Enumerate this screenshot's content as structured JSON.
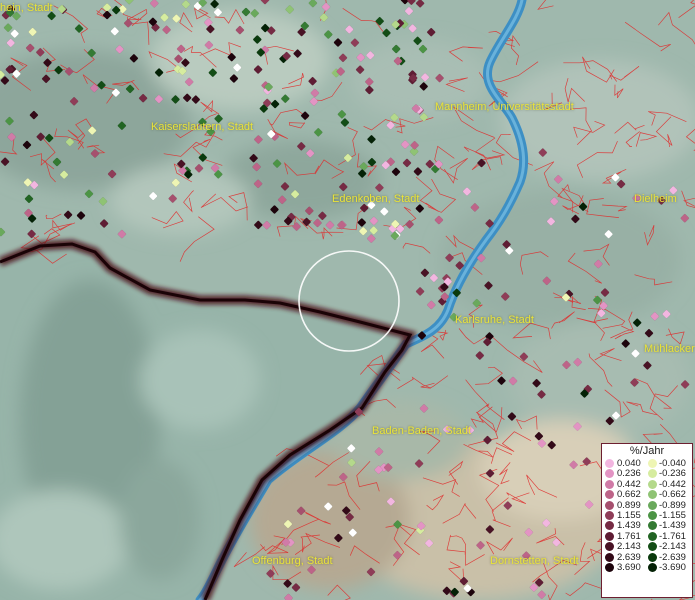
{
  "map": {
    "cities": [
      {
        "id": "ludwigshafen",
        "label": "hein, Stadt"
      },
      {
        "id": "kaiserslautern",
        "label": "Kaiserslautern, Stadt"
      },
      {
        "id": "mannheim",
        "label": "Mannheim, Universitätsstadt"
      },
      {
        "id": "edenkoben",
        "label": "Edenkoben, Stadt"
      },
      {
        "id": "dielheim",
        "label": "Dielheim"
      },
      {
        "id": "karlsruhe",
        "label": "Karlsruhe, Stadt"
      },
      {
        "id": "muehlacker",
        "label": "Mühlacker"
      },
      {
        "id": "baden-baden",
        "label": "Baden-Baden, Stadt"
      },
      {
        "id": "offenburg",
        "label": "Offenburg, Stadt"
      },
      {
        "id": "dornstetten",
        "label": "Dornstetten, Stadt"
      }
    ],
    "colors": {
      "river": "#3d8fc4",
      "border": "#5a0e1c",
      "municipal_lines": "#e32b2b",
      "label_text": "#e9e33a"
    }
  },
  "legend": {
    "title": "%/Jahr",
    "positive": [
      {
        "value": "0.040",
        "color": "#f2b6e0"
      },
      {
        "value": "0.236",
        "color": "#e394c4"
      },
      {
        "value": "0.442",
        "color": "#d07ba7"
      },
      {
        "value": "0.662",
        "color": "#bd6488"
      },
      {
        "value": "0.899",
        "color": "#a6506e"
      },
      {
        "value": "1.155",
        "color": "#8f3d58"
      },
      {
        "value": "1.439",
        "color": "#762b44"
      },
      {
        "value": "1.761",
        "color": "#5f1d34"
      },
      {
        "value": "2.143",
        "color": "#491325"
      },
      {
        "value": "2.639",
        "color": "#330a18"
      },
      {
        "value": "3.690",
        "color": "#1d040c"
      }
    ],
    "negative": [
      {
        "value": "-0.040",
        "color": "#eef5b4"
      },
      {
        "value": "-0.236",
        "color": "#d6ec9f"
      },
      {
        "value": "-0.442",
        "color": "#b4d98b"
      },
      {
        "value": "-0.662",
        "color": "#8fc374"
      },
      {
        "value": "-0.899",
        "color": "#6aa95c"
      },
      {
        "value": "-1.155",
        "color": "#4c9445"
      },
      {
        "value": "-1.439",
        "color": "#347a33"
      },
      {
        "value": "-1.761",
        "color": "#226423"
      },
      {
        "value": "-2.143",
        "color": "#134d16"
      },
      {
        "value": "-2.639",
        "color": "#0a3a0d"
      },
      {
        "value": "-3.690",
        "color": "#042206"
      }
    ]
  }
}
